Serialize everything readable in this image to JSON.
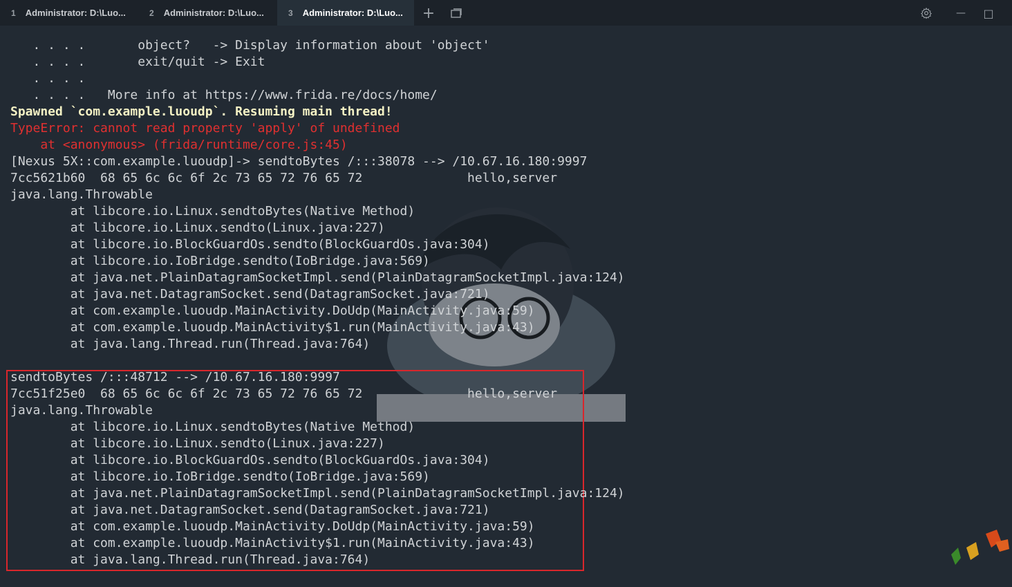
{
  "tabs": [
    {
      "num": "1",
      "title": "Administrator: D:\\Luo..."
    },
    {
      "num": "2",
      "title": "Administrator: D:\\Luo..."
    },
    {
      "num": "3",
      "title": "Administrator: D:\\Luo..."
    }
  ],
  "icons": {
    "new_tab": "+",
    "dropdown": "panel-icon",
    "settings": "gear-icon",
    "minimize": "—",
    "maximize": "□"
  },
  "colors": {
    "background": "#222a33",
    "highlight": "#d9262c",
    "error": "#e03030",
    "yellow": "#f4f1c4"
  },
  "terminal": {
    "lines": [
      "   . . . .       object?   -> Display information about 'object'",
      "   . . . .       exit/quit -> Exit",
      "   . . . .",
      "   . . . .   More info at https://www.frida.re/docs/home/",
      "Spawned `com.example.luoudp`. Resuming main thread!",
      "TypeError: cannot read property 'apply' of undefined",
      "    at <anonymous> (frida/runtime/core.js:45)",
      "[Nexus 5X::com.example.luoudp]-> sendtoBytes /:::38078 --> /10.67.16.180:9997",
      "7cc5621b60  68 65 6c 6c 6f 2c 73 65 72 76 65 72              hello,server",
      "java.lang.Throwable",
      "        at libcore.io.Linux.sendtoBytes(Native Method)",
      "        at libcore.io.Linux.sendto(Linux.java:227)",
      "        at libcore.io.BlockGuardOs.sendto(BlockGuardOs.java:304)",
      "        at libcore.io.IoBridge.sendto(IoBridge.java:569)",
      "        at java.net.PlainDatagramSocketImpl.send(PlainDatagramSocketImpl.java:124)",
      "        at java.net.DatagramSocket.send(DatagramSocket.java:721)",
      "        at com.example.luoudp.MainActivity.DoUdp(MainActivity.java:59)",
      "        at com.example.luoudp.MainActivity$1.run(MainActivity.java:43)",
      "        at java.lang.Thread.run(Thread.java:764)",
      "",
      "sendtoBytes /:::48712 --> /10.67.16.180:9997",
      "7cc51f25e0  68 65 6c 6c 6f 2c 73 65 72 76 65 72              hello,server",
      "java.lang.Throwable",
      "        at libcore.io.Linux.sendtoBytes(Native Method)",
      "        at libcore.io.Linux.sendto(Linux.java:227)",
      "        at libcore.io.BlockGuardOs.sendto(BlockGuardOs.java:304)",
      "        at libcore.io.IoBridge.sendto(IoBridge.java:569)",
      "        at java.net.PlainDatagramSocketImpl.send(PlainDatagramSocketImpl.java:124)",
      "        at java.net.DatagramSocket.send(DatagramSocket.java:721)",
      "        at com.example.luoudp.MainActivity.DoUdp(MainActivity.java:59)",
      "        at com.example.luoudp.MainActivity$1.run(MainActivity.java:43)",
      "        at java.lang.Thread.run(Thread.java:764)"
    ]
  }
}
